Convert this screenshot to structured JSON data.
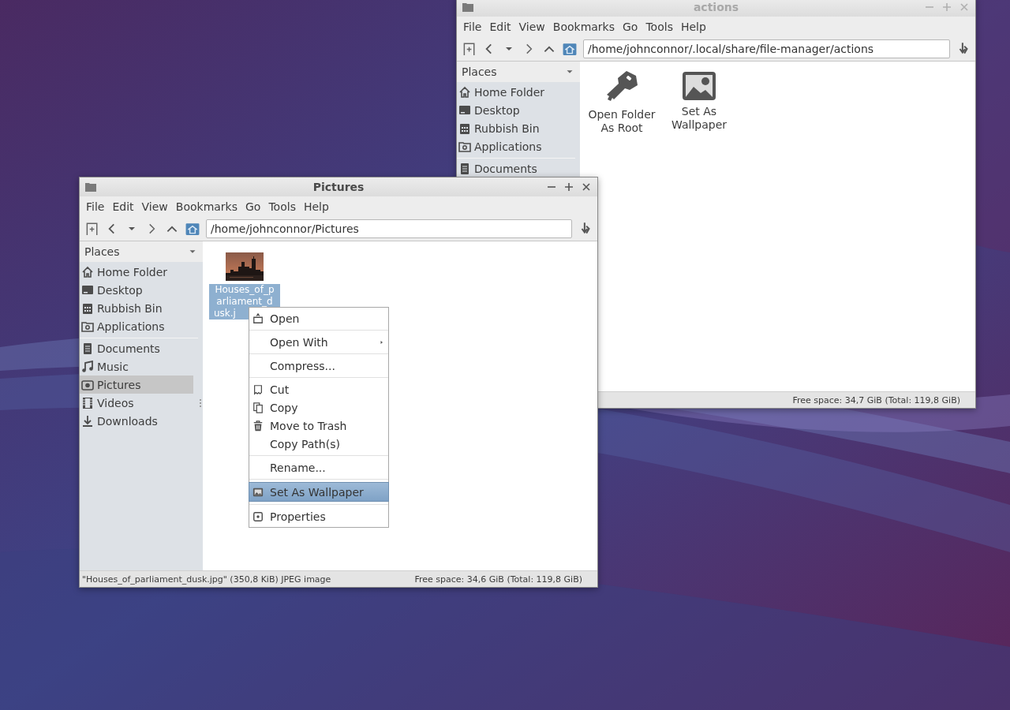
{
  "windows": [
    {
      "title": "actions",
      "active": false,
      "menu": [
        "File",
        "Edit",
        "View",
        "Bookmarks",
        "Go",
        "Tools",
        "Help"
      ],
      "path": "/home/johnconnor/.local/share/file-manager/actions",
      "sidebar": {
        "header": "Places",
        "sections": [
          [
            {
              "label": "Home Folder",
              "selected": false
            },
            {
              "label": "Desktop",
              "selected": false
            },
            {
              "label": "Rubbish Bin",
              "selected": false
            },
            {
              "label": "Applications",
              "selected": false
            }
          ],
          [
            {
              "label": "Documents",
              "selected": false
            }
          ]
        ]
      },
      "files": [
        {
          "name": "Open Folder As Root",
          "kind": "icon",
          "selected": false
        },
        {
          "name": "Set As Wallpaper",
          "kind": "icon",
          "selected": false
        }
      ],
      "status": {
        "right": "Free space: 34,7 GiB (Total: 119,8 GiB)"
      }
    },
    {
      "title": "Pictures",
      "active": true,
      "menu": [
        "File",
        "Edit",
        "View",
        "Bookmarks",
        "Go",
        "Tools",
        "Help"
      ],
      "path": "/home/johnconnor/Pictures",
      "sidebar": {
        "header": "Places",
        "sections": [
          [
            {
              "label": "Home Folder",
              "selected": false
            },
            {
              "label": "Desktop",
              "selected": false
            },
            {
              "label": "Rubbish Bin",
              "selected": false
            },
            {
              "label": "Applications",
              "selected": false
            }
          ],
          [
            {
              "label": "Documents",
              "selected": false
            },
            {
              "label": "Music",
              "selected": false
            },
            {
              "label": "Pictures",
              "selected": true
            },
            {
              "label": "Videos",
              "selected": false
            },
            {
              "label": "Downloads",
              "selected": false
            }
          ]
        ]
      },
      "files": [
        {
          "name": "Houses_of_parliament_dusk.j",
          "kind": "picture",
          "selected": true
        }
      ],
      "status": {
        "left": "\"Houses_of_parliament_dusk.jpg\" (350,8 KiB) JPEG image",
        "right": "Free space: 34,6 GiB (Total: 119,8 GiB)"
      }
    }
  ],
  "context_menu": {
    "groups": [
      [
        {
          "label": "Open",
          "selected": false,
          "submenu": false
        }
      ],
      [
        {
          "label": "Open With",
          "selected": false,
          "submenu": true
        }
      ],
      [
        {
          "label": "Compress...",
          "selected": false,
          "submenu": false
        }
      ],
      [
        {
          "label": "Cut",
          "selected": false,
          "submenu": false
        },
        {
          "label": "Copy",
          "selected": false,
          "submenu": false
        },
        {
          "label": "Move to Trash",
          "selected": false,
          "submenu": false
        },
        {
          "label": "Copy Path(s)",
          "selected": false,
          "submenu": false
        }
      ],
      [
        {
          "label": "Rename...",
          "selected": false,
          "submenu": false
        }
      ],
      [
        {
          "label": "Set As Wallpaper",
          "selected": true,
          "submenu": false
        }
      ],
      [
        {
          "label": "Properties",
          "selected": false,
          "submenu": false
        }
      ]
    ]
  }
}
